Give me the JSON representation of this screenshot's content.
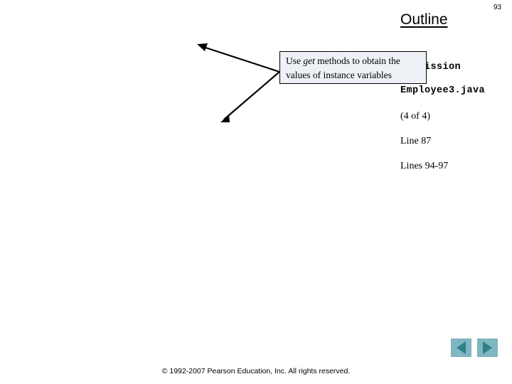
{
  "slide": {
    "page_number": "93",
    "title": "Outline",
    "title_icon": "underline-heading"
  },
  "outline": {
    "file_name_line_1": "Commission",
    "file_name_line_2": "Employee3.java",
    "count_label": "(4 of 4)",
    "reference_line_1": "Line 87",
    "reference_line_2": "Lines 94-97"
  },
  "callout": {
    "text_prefix": "Use ",
    "text_emphasis": "get",
    "text_suffix": " methods to obtain the values of instance variables",
    "fill_color": "#eef2f7",
    "border_color": "#000000",
    "arrow_count": 2
  },
  "navigation": {
    "previous_label": "◀",
    "previous_name": "previous-slide",
    "next_label": "▶",
    "next_name": "next-slide",
    "button_color": "#7fb6bf",
    "glyph_color": "#2f7f8c"
  },
  "footer": {
    "copyright": "© 1992-2007 Pearson Education, Inc.  All rights reserved."
  }
}
